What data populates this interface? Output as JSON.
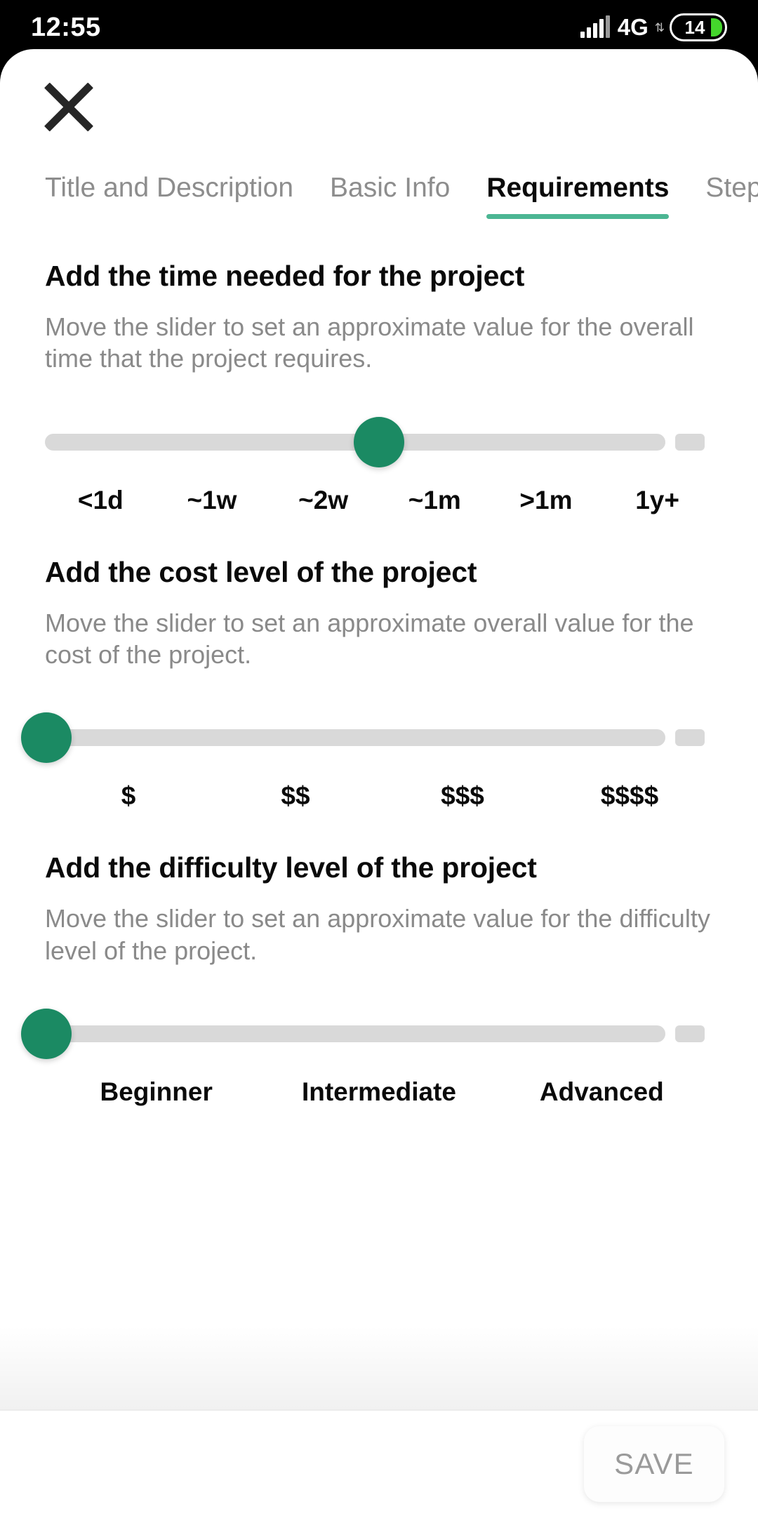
{
  "status_bar": {
    "time": "12:55",
    "network_type": "4G",
    "network_arrows_icon": "data-transfer-arrows-icon",
    "signal_icon": "signal-bars-icon",
    "battery_level": "14",
    "battery_icon": "battery-icon",
    "battery_fill_color": "#44d62c"
  },
  "header": {
    "close_icon": "close-icon"
  },
  "tabs": {
    "active_index": 2,
    "accent_color": "#4cb693",
    "items": [
      {
        "label": "Title and Description"
      },
      {
        "label": "Basic Info"
      },
      {
        "label": "Requirements"
      },
      {
        "label": "Steps"
      }
    ]
  },
  "sections": [
    {
      "title": "Add the time needed for the project",
      "description": "Move the slider to set an approximate value for the overall time that the project requires.",
      "slider": {
        "name": "time-slider",
        "value_index": 3,
        "value_label": "~1m",
        "percent": 50,
        "thumb_color": "#1b8a63",
        "track_color": "#d9d9d9",
        "ticks": [
          "<1d",
          "~1w",
          "~2w",
          "~1m",
          ">1m",
          "1y+"
        ]
      }
    },
    {
      "title": "Add the cost level of the project",
      "description": "Move the slider to set an approximate overall value for the cost of the project.",
      "slider": {
        "name": "cost-slider",
        "value_index": 0,
        "value_label": "$",
        "percent": 0,
        "thumb_color": "#1b8a63",
        "track_color": "#d9d9d9",
        "ticks": [
          "$",
          "$$",
          "$$$",
          "$$$$"
        ]
      }
    },
    {
      "title": "Add the difficulty level of the project",
      "description": "Move the slider to set an approximate value for the difficulty level of the project.",
      "slider": {
        "name": "difficulty-slider",
        "value_index": 0,
        "value_label": "Beginner",
        "percent": 0,
        "thumb_color": "#1b8a63",
        "track_color": "#d9d9d9",
        "ticks": [
          "Beginner",
          "Intermediate",
          "Advanced"
        ]
      }
    }
  ],
  "footer": {
    "save_label": "SAVE"
  }
}
